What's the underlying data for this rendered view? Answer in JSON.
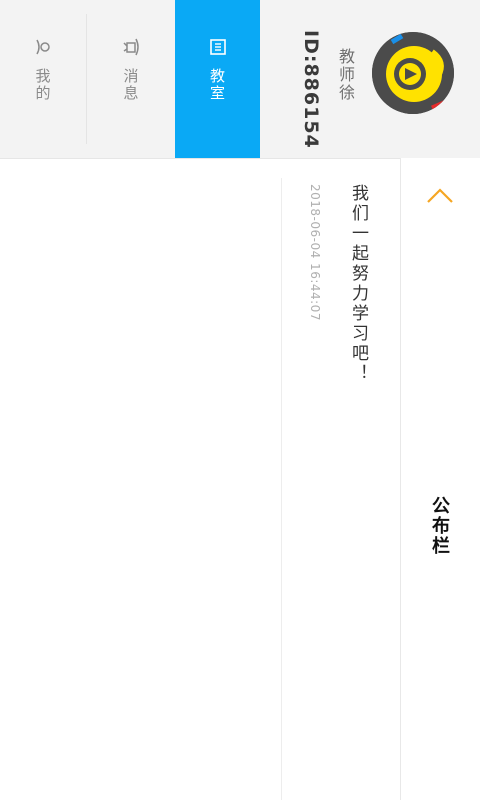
{
  "user": {
    "name": "教师徐",
    "id_label": "ID:886154"
  },
  "nav": {
    "tabs": [
      {
        "label": "我的",
        "icon": "person-icon",
        "active": false
      },
      {
        "label": "消息",
        "icon": "speaker-icon",
        "active": false
      },
      {
        "label": "教室",
        "icon": "classroom-icon",
        "active": true
      }
    ]
  },
  "bulletin": {
    "title": "公布栏",
    "posts": [
      {
        "text": "我们一起努力学习吧！",
        "time": "2018-06-04 16:44:07"
      }
    ]
  },
  "colors": {
    "active_tab": "#0aa9f5",
    "accent": "#f5a623",
    "header_bg": "#f3f3f3"
  }
}
